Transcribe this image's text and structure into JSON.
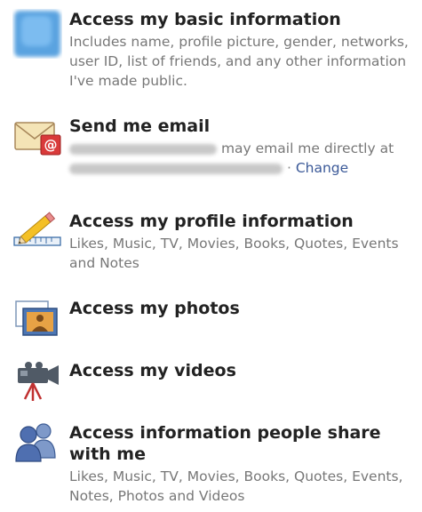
{
  "permissions": [
    {
      "title": "Access my basic information",
      "desc": "Includes name, profile picture, gender, networks, user ID, list of friends, and any other information I've made public.",
      "icon": "blurred-app-icon"
    },
    {
      "title": "Send me email",
      "desc_mid": "may email me directly at",
      "change_label": "Change",
      "icon": "email-icon"
    },
    {
      "title": "Access my profile information",
      "desc": "Likes, Music, TV, Movies, Books, Quotes, Events and Notes",
      "icon": "pencil-ruler-icon"
    },
    {
      "title": "Access my photos",
      "icon": "photos-icon"
    },
    {
      "title": "Access my videos",
      "icon": "video-camera-icon"
    },
    {
      "title": "Access information people share with me",
      "desc": "Likes, Music, TV, Movies, Books, Quotes, Events, Notes, Photos and Videos",
      "icon": "people-icon"
    }
  ],
  "colors": {
    "title": "#222222",
    "desc": "#777777",
    "link": "#3b5998",
    "email_red": "#d93a3a",
    "people_blue": "#4f6fb0"
  }
}
